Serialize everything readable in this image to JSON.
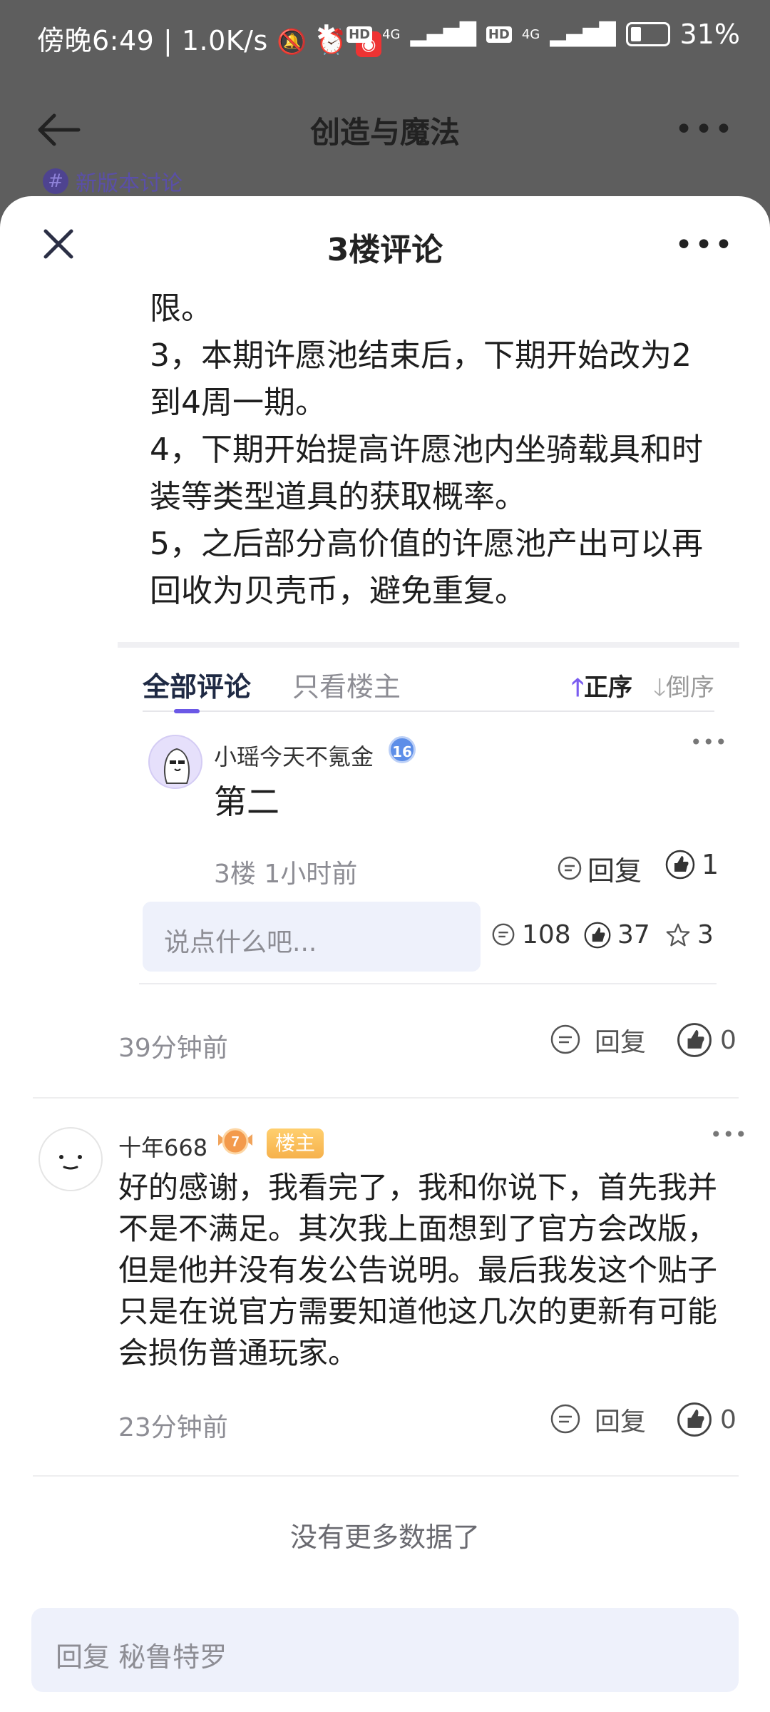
{
  "status_bar": {
    "time": "傍晚6:49",
    "net_speed": "1.0K/s",
    "hd1": "HD",
    "sig1": "4G",
    "hd2": "HD",
    "sig2": "4G",
    "battery": "31%"
  },
  "background_page": {
    "title": "创造与魔法",
    "tag": "新版本讨论"
  },
  "sheet": {
    "title": "3楼评论"
  },
  "quoted_post": {
    "lines": [
      "限。",
      "3，本期许愿池结束后，下期开始改为2到4周一期。",
      "4，下期开始提高许愿池内坐骑载具和时装等类型道具的获取概率。",
      "5，之后部分高价值的许愿池产出可以再回收为贝壳币，避免重复。"
    ]
  },
  "tabs": {
    "all": "全部评论",
    "owner_only": "只看楼主",
    "sort_asc": "正序",
    "sort_desc": "倒序"
  },
  "nested_comment": {
    "username": "小瑶今天不氪金",
    "level": "16",
    "content": "第二",
    "floor": "3楼",
    "time": "1小时前",
    "reply_label": "回复",
    "likes": "1"
  },
  "comment_box": {
    "placeholder": "说点什么吧..."
  },
  "stats": {
    "comments": "108",
    "likes": "37",
    "stars": "3"
  },
  "floor3_footer": {
    "time": "39分钟前",
    "reply_label": "回复",
    "likes": "0"
  },
  "reply_comment": {
    "username": "十年668",
    "level": "7",
    "owner_badge": "楼主",
    "content": "好的感谢，我看完了，我和你说下，首先我并不是不满足。其次我上面想到了官方会改版，但是他并没有发公告说明。最后我发这个贴子只是在说官方需要知道他这几次的更新有可能会损伤普通玩家。",
    "time": "23分钟前",
    "reply_label": "回复",
    "likes": "0"
  },
  "no_more": "没有更多数据了",
  "reply_input": {
    "placeholder": "回复 秘鲁特罗"
  },
  "colors": {
    "accent": "#6b58e6",
    "input_bg": "#eef1fb",
    "owner_badge": "#f6b14c"
  }
}
